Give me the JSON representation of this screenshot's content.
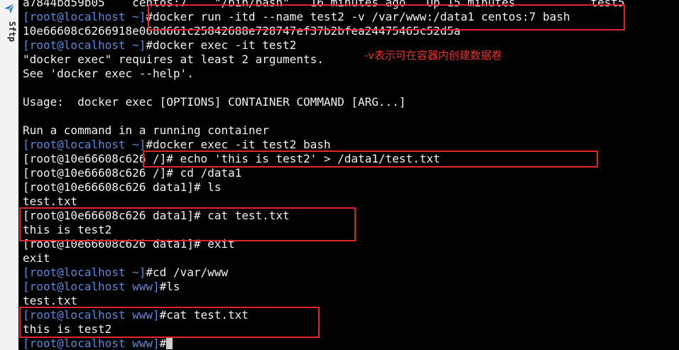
{
  "sidebar": {
    "tab_label": "Sftp",
    "icon": "send-icon"
  },
  "colors": {
    "prompt": "#5a8ad8",
    "text": "#f0f0f0",
    "highlight": "#e0242c",
    "annotation": "#e8332a"
  },
  "terminal": {
    "lines": [
      {
        "prompt": "",
        "text": "a7844bd59b05    centos:7    \"/bin/bash\"   16 minutes ago   Up 15 minutes           test5"
      },
      {
        "prompt": "[root@localhost ~]",
        "text": "#docker run -itd --name test2 -v /var/www:/data1 centos:7 bash"
      },
      {
        "prompt": "",
        "text": "10e66608c6266918e068d661c25842688e728747ef37b2bfea24475465c52d5a"
      },
      {
        "prompt": "[root@localhost ~]",
        "text": "#docker exec -it test2"
      },
      {
        "prompt": "",
        "text": "\"docker exec\" requires at least 2 arguments."
      },
      {
        "prompt": "",
        "text": "See 'docker exec --help'."
      },
      {
        "prompt": "",
        "text": ""
      },
      {
        "prompt": "",
        "text": "Usage:  docker exec [OPTIONS] CONTAINER COMMAND [ARG...]"
      },
      {
        "prompt": "",
        "text": ""
      },
      {
        "prompt": "",
        "text": "Run a command in a running container"
      },
      {
        "prompt": "[root@localhost ~]",
        "text": "#docker exec -it test2 bash"
      },
      {
        "prompt": "",
        "text": "[root@10e66608c626 /]# echo 'this is test2' > /data1/test.txt"
      },
      {
        "prompt": "",
        "text": "[root@10e66608c626 /]# cd /data1"
      },
      {
        "prompt": "",
        "text": "[root@10e66608c626 data1]# ls"
      },
      {
        "prompt": "",
        "text": "test.txt"
      },
      {
        "prompt": "",
        "text": "[root@10e66608c626 data1]# cat test.txt"
      },
      {
        "prompt": "",
        "text": "this is test2"
      },
      {
        "prompt": "",
        "text": "[root@10e66608c626 data1]# exit"
      },
      {
        "prompt": "",
        "text": "exit"
      },
      {
        "prompt": "[root@localhost ~]",
        "text": "#cd /var/www"
      },
      {
        "prompt": "[root@localhost www]",
        "text": "#ls"
      },
      {
        "prompt": "",
        "text": "test.txt"
      },
      {
        "prompt": "[root@localhost www]",
        "text": "#cat test.txt"
      },
      {
        "prompt": "",
        "text": "this is test2"
      },
      {
        "prompt": "[root@localhost www]",
        "text": "#",
        "cursor": true
      }
    ]
  },
  "annotation": {
    "text": "-v表示可在容器内创建数据卷"
  }
}
